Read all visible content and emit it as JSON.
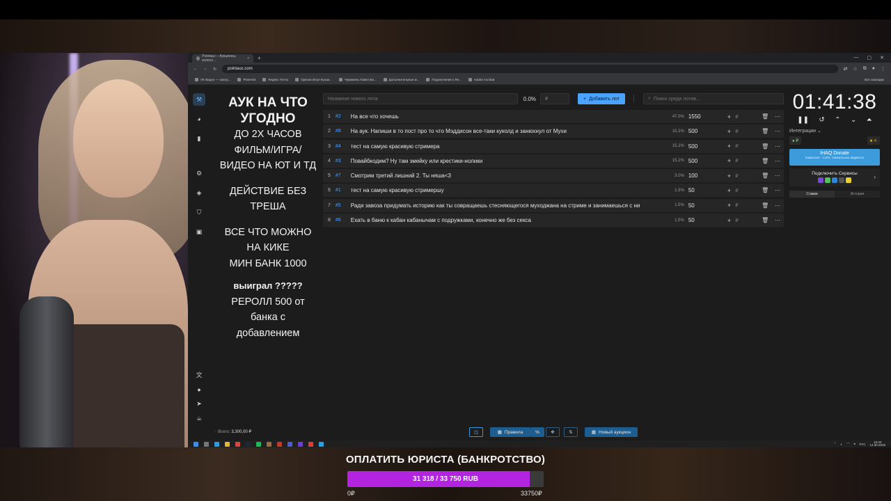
{
  "browser": {
    "tab_title": "Pointauc – Аукционы, колесо...",
    "url": "pointauc.com",
    "bookmarks": [
      "VK Видео — смотр...",
      "Pinterest",
      "Яндекс Почта",
      "Орехов Илья Кузьм...",
      "Черемень Павел Ва...",
      "Дополнительные м...",
      "Подключение к Ян...",
      "Adobe Acrobat"
    ],
    "bookmarks_all": "Все закладки"
  },
  "rules": {
    "title": "АУК НА ЧТО УГОДНО",
    "line1": "ДО 2Х ЧАСОВ",
    "line2": "ФИЛЬМ/ИГРА/",
    "line3": "ВИДЕО НА ЮТ И ТД",
    "line4": "ДЕЙСТВИЕ БЕЗ",
    "line5": "ТРЕША",
    "line6": "ВСЕ ЧТО МОЖНО",
    "line7": "НА КИКЕ",
    "line8": "МИН БАНК 1000",
    "line9": "выиграл ?????",
    "line10": "РЕРОЛЛ 500 от",
    "line11": "банка с",
    "line12": "добавлением"
  },
  "controls": {
    "lot_placeholder": "Название нового лота",
    "percent": "0.0%",
    "amount_placeholder": "₽",
    "add_button": "Добавить лот",
    "search_placeholder": "Поиск среди лотов..."
  },
  "lots": [
    {
      "idx": "1",
      "tag": "#2",
      "name": "На все что хочешь",
      "pct": "47.0%",
      "amount": "1550"
    },
    {
      "idx": "2",
      "tag": "#8",
      "name": "На аук. Напиши в то пост про то что Мэддисон все-таки куколд и занюхнул от Мухи",
      "pct": "15.2%",
      "amount": "500"
    },
    {
      "idx": "3",
      "tag": "#4",
      "name": "тест на самую красивую стримера",
      "pct": "15.2%",
      "amount": "500"
    },
    {
      "idx": "4",
      "tag": "#3",
      "name": "Повайбкодим? Ну там змейку или крестики-нолики",
      "pct": "15.2%",
      "amount": "500"
    },
    {
      "idx": "5",
      "tag": "#7",
      "name": "Смотрим третий лишний 2. Ты няша<3",
      "pct": "3.0%",
      "amount": "100"
    },
    {
      "idx": "6",
      "tag": "#1",
      "name": "тест на самую красивую стримершу",
      "pct": "1.5%",
      "amount": "50"
    },
    {
      "idx": "7",
      "tag": "#5",
      "name": "Ради завоза придумать историю как ты совращаешь стесняющегося муходжана на стриме и занимаешься с ни",
      "pct": "1.5%",
      "amount": "50"
    },
    {
      "idx": "8",
      "tag": "#6",
      "name": "Ехать в баню к кабан кабанычам с подружками, конечно же без секса",
      "pct": "1.5%",
      "amount": "50"
    }
  ],
  "timer": {
    "time": "01:41:38",
    "integrations_label": "Интеграции",
    "donate_title": "IHAQ Donate",
    "donate_sub": "Комиссия – 3,5%. Уникальные виджеты!",
    "services_label": "Подключить Сервисы",
    "tab_bids": "Ставки",
    "tab_history": "История"
  },
  "bottom": {
    "total_label": "Всего:",
    "total_value": "3,300,00 ₽",
    "rules_button": "Правила",
    "new_auction": "Новый аукцион"
  },
  "taskbar": {
    "lang": "РУС",
    "time": "15:33",
    "date": "14.05.2026"
  },
  "goal": {
    "title": "ОПЛАТИТЬ ЮРИСТА (БАНКРОТСТВО)",
    "progress_text": "31 318 / 33 750 RUB",
    "progress_fraction": 0.928,
    "min_label": "0₽",
    "max_label": "33750₽",
    "bar_color": "#b324e0"
  }
}
